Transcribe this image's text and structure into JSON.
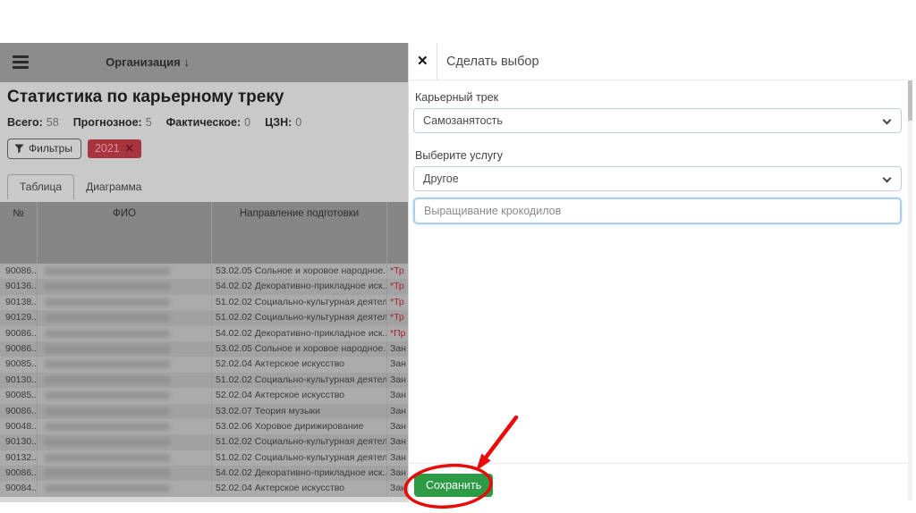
{
  "navbar": {
    "org_label": "Организация",
    "dropdown_arrow": "↓"
  },
  "page": {
    "title": "Статистика по карьерному треку",
    "stats": [
      {
        "label": "Всего:",
        "value": "58"
      },
      {
        "label": "Прогнозное:",
        "value": "5"
      },
      {
        "label": "Фактическое:",
        "value": "0"
      },
      {
        "label": "ЦЗН:",
        "value": "0"
      }
    ],
    "filters": {
      "button_label": "Фильтры",
      "badge_label": "2021",
      "badge_close_icon": "✕"
    },
    "tabs": [
      {
        "label": "Таблица",
        "active": true
      },
      {
        "label": "Диаграмма",
        "active": false
      }
    ]
  },
  "table": {
    "columns": [
      "№",
      "ФИО",
      "Направление подготовки",
      ""
    ],
    "rows": [
      {
        "id": "90086...",
        "program": "53.02.05 Сольное и хоровое народное...",
        "status": "*Тр",
        "red": true
      },
      {
        "id": "90136...",
        "program": "54.02.02 Декоративно-прикладное иск...",
        "status": "*Тр",
        "red": true
      },
      {
        "id": "90138...",
        "program": "51.02.02 Социально-культурная деятел...",
        "status": "*Тр",
        "red": true
      },
      {
        "id": "90129...",
        "program": "51.02.02 Социально-культурная деятел...",
        "status": "*Тр",
        "red": true
      },
      {
        "id": "90086...",
        "program": "54.02.02 Декоративно-прикладное иск...",
        "status": "*Пр",
        "red": true
      },
      {
        "id": "90086...",
        "program": "53.02.05 Сольное и хоровое народное...",
        "status": "Зан",
        "red": false
      },
      {
        "id": "90085...",
        "program": "52.02.04 Актерское искусство",
        "status": "Зан",
        "red": false
      },
      {
        "id": "90130...",
        "program": "51.02.02 Социально-культурная деятел...",
        "status": "Зан",
        "red": false
      },
      {
        "id": "90085...",
        "program": "52.02.04 Актерское искусство",
        "status": "Зан",
        "red": false
      },
      {
        "id": "90086...",
        "program": "53.02.07 Теория музыки",
        "status": "Зан",
        "red": false
      },
      {
        "id": "90048...",
        "program": "53.02.06 Хоровое дирижирование",
        "status": "Зан",
        "red": false
      },
      {
        "id": "90130...",
        "program": "51.02.02 Социально-культурная деятел...",
        "status": "Зан",
        "red": false
      },
      {
        "id": "90132...",
        "program": "51.02.02 Социально-культурная деятел...",
        "status": "Зан",
        "red": false
      },
      {
        "id": "90086...",
        "program": "54.02.02 Декоративно-прикладное иск...",
        "status": "Зан",
        "red": false
      },
      {
        "id": "90084...",
        "program": "52.02.04 Актерское искусство",
        "status": "Зан",
        "red": false
      }
    ]
  },
  "modal": {
    "close_icon": "✕",
    "title": "Сделать выбор",
    "career_track": {
      "label": "Карьерный трек",
      "value": "Самозанятость"
    },
    "service": {
      "label": "Выберите услугу",
      "value": "Другое"
    },
    "custom_service_value": "Выращивание крокодилов",
    "save_button": "Сохранить"
  },
  "colors": {
    "badge_red": "#a83440",
    "status_red": "#a2252f",
    "save_green": "#2d9b45",
    "annotation_red": "#e80b0b",
    "input_focus_blue": "#a9cfee"
  }
}
